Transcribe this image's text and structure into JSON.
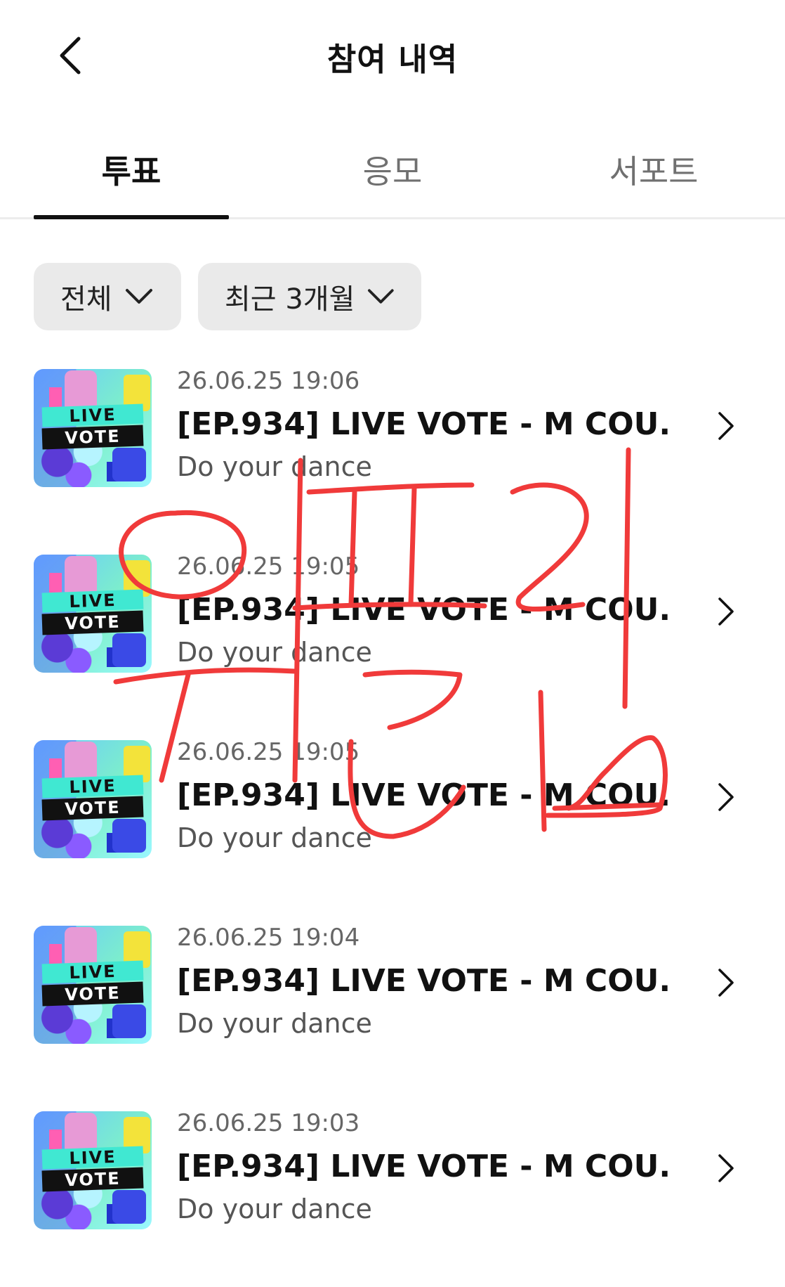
{
  "header": {
    "title": "참여 내역",
    "back_icon": "chevron-left-icon"
  },
  "tabs": [
    {
      "label": "투표",
      "active": true
    },
    {
      "label": "응모",
      "active": false
    },
    {
      "label": "서포트",
      "active": false
    }
  ],
  "filters": {
    "type_label": "전체",
    "period_label": "최근 3개월",
    "chevron_icon": "chevron-down-icon"
  },
  "thumbnail": {
    "line1": "LIVE",
    "line2": "VOTE"
  },
  "items": [
    {
      "date": "26.06.25 19:06",
      "title": "[EP.934] LIVE VOTE - M COU...",
      "subtitle": "Do your dance"
    },
    {
      "date": "26.06.25 19:05",
      "title": "[EP.934] LIVE VOTE - M COU...",
      "subtitle": "Do your dance"
    },
    {
      "date": "26.06.25 19:05",
      "title": "[EP.934] LIVE VOTE - M COU...",
      "subtitle": "Do your dance"
    },
    {
      "date": "26.06.25 19:04",
      "title": "[EP.934] LIVE VOTE - M COU...",
      "subtitle": "Do your dance"
    },
    {
      "date": "26.06.25 19:03",
      "title": "[EP.934] LIVE VOTE - M COU...",
      "subtitle": "Do your dance"
    }
  ],
  "colors": {
    "accent_active": "#111111",
    "scribble": "#f03a3a",
    "chip_bg": "#eaeaea"
  }
}
